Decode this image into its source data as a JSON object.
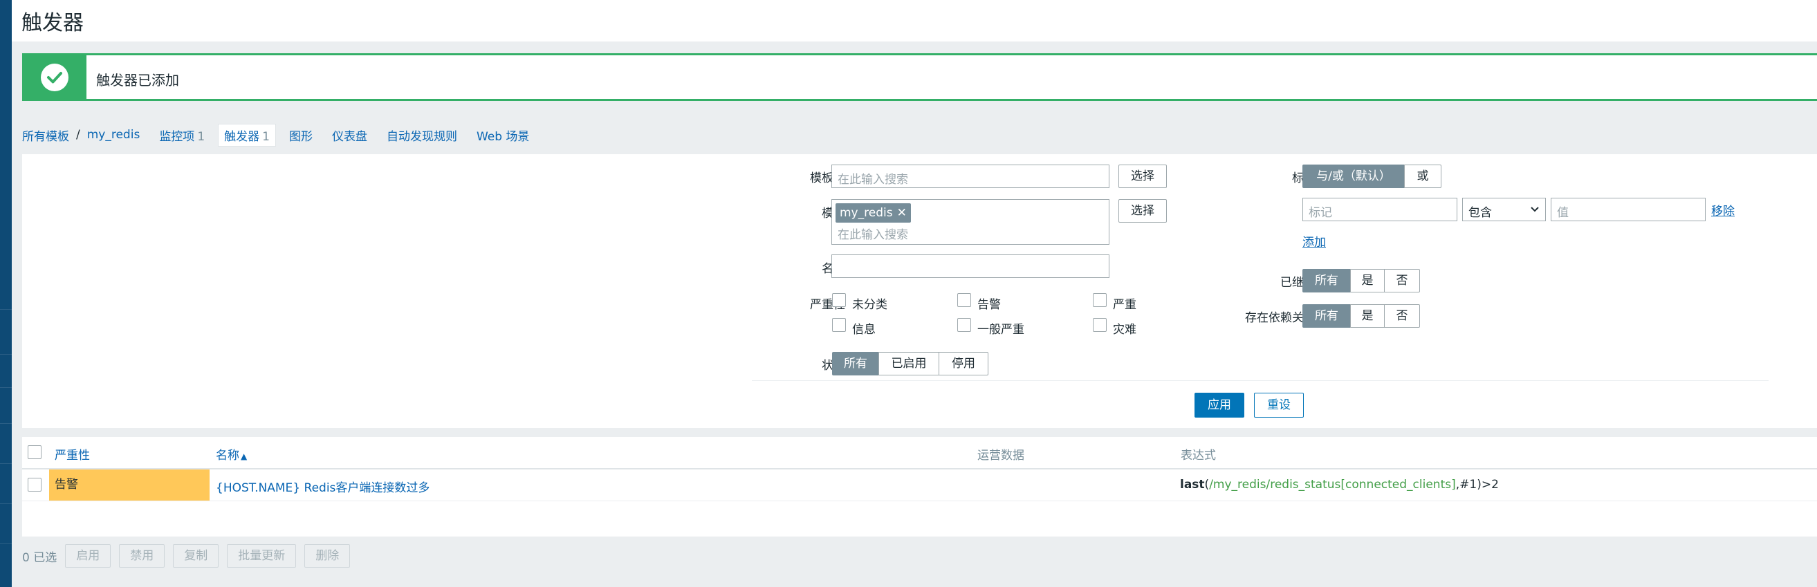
{
  "page": {
    "title": "触发器"
  },
  "banner": {
    "message": "触发器已添加"
  },
  "nav": {
    "all_templates": "所有模板",
    "separator": "/",
    "template": "my_redis",
    "items": [
      {
        "label": "监控项",
        "count": "1"
      },
      {
        "label": "触发器",
        "count": "1"
      },
      {
        "label": "图形",
        "count": ""
      },
      {
        "label": "仪表盘",
        "count": ""
      },
      {
        "label": "自动发现规则",
        "count": ""
      },
      {
        "label": "Web 场景",
        "count": ""
      }
    ]
  },
  "filter": {
    "template_group": {
      "label": "模板组",
      "placeholder": "在此输入搜索",
      "select": "选择"
    },
    "template": {
      "label": "模板",
      "chip": "my_redis",
      "chip_remove": "✕",
      "placeholder": "在此输入搜索",
      "select": "选择"
    },
    "name": {
      "label": "名称",
      "value": ""
    },
    "severity": {
      "label": "严重性",
      "options": [
        "未分类",
        "告警",
        "严重",
        "信息",
        "一般严重",
        "灾难"
      ]
    },
    "status": {
      "label": "状态",
      "options": [
        "所有",
        "已启用",
        "停用"
      ],
      "selected": "所有"
    },
    "tags": {
      "label": "标记",
      "mode_options": [
        "与/或（默认）",
        "或"
      ],
      "mode_selected": "与/或（默认）",
      "tag_placeholder": "标记",
      "operator": "包含",
      "value_placeholder": "值",
      "remove": "移除",
      "add": "添加"
    },
    "inherited": {
      "label": "已继承",
      "options": [
        "所有",
        "是",
        "否"
      ],
      "selected": "所有"
    },
    "dependencies": {
      "label": "存在依赖关系",
      "options": [
        "所有",
        "是",
        "否"
      ],
      "selected": "所有"
    },
    "apply": "应用",
    "reset": "重设"
  },
  "table": {
    "columns": {
      "severity": "严重性",
      "name": "名称",
      "sort_indicator": "▲",
      "operational_data": "运营数据",
      "expression": "表达式"
    },
    "rows": [
      {
        "severity": "告警",
        "severity_color": "#ffc859",
        "name": "{HOST.NAME} Redis客户端连接数过多",
        "operational_data": "",
        "expression": {
          "fn": "last",
          "open": "(",
          "item": "/my_redis/redis_status[connected_clients]",
          "rest": ",#1)>2"
        }
      }
    ]
  },
  "footer": {
    "selected": "0 已选",
    "buttons": [
      "启用",
      "禁用",
      "复制",
      "批量更新",
      "删除"
    ]
  },
  "colors": {
    "accent": "#0275b8",
    "link": "#0a66b3",
    "success": "#34af67",
    "warning": "#ffc859",
    "segment_selected": "#768d99",
    "sidebar": "#0e4a75"
  }
}
